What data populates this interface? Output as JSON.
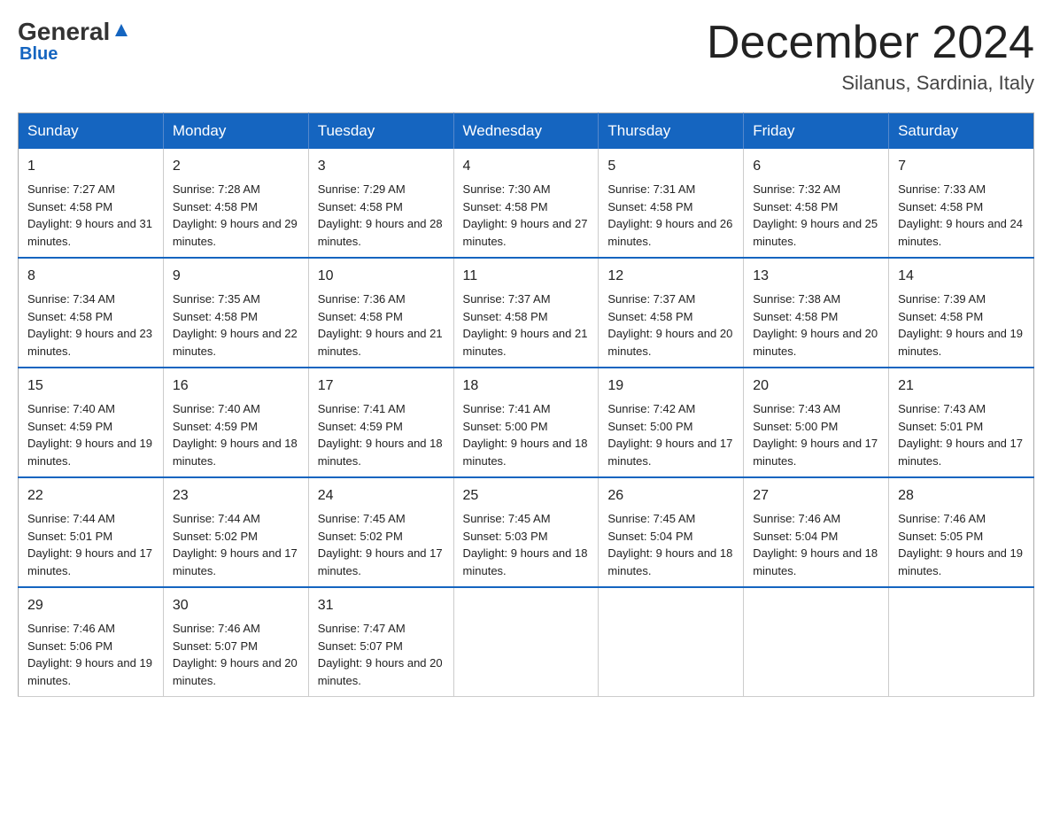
{
  "header": {
    "logo_general": "General",
    "logo_blue": "Blue",
    "month": "December 2024",
    "location": "Silanus, Sardinia, Italy"
  },
  "days_of_week": [
    "Sunday",
    "Monday",
    "Tuesday",
    "Wednesday",
    "Thursday",
    "Friday",
    "Saturday"
  ],
  "weeks": [
    [
      {
        "day": "1",
        "sunrise": "7:27 AM",
        "sunset": "4:58 PM",
        "daylight": "9 hours and 31 minutes."
      },
      {
        "day": "2",
        "sunrise": "7:28 AM",
        "sunset": "4:58 PM",
        "daylight": "9 hours and 29 minutes."
      },
      {
        "day": "3",
        "sunrise": "7:29 AM",
        "sunset": "4:58 PM",
        "daylight": "9 hours and 28 minutes."
      },
      {
        "day": "4",
        "sunrise": "7:30 AM",
        "sunset": "4:58 PM",
        "daylight": "9 hours and 27 minutes."
      },
      {
        "day": "5",
        "sunrise": "7:31 AM",
        "sunset": "4:58 PM",
        "daylight": "9 hours and 26 minutes."
      },
      {
        "day": "6",
        "sunrise": "7:32 AM",
        "sunset": "4:58 PM",
        "daylight": "9 hours and 25 minutes."
      },
      {
        "day": "7",
        "sunrise": "7:33 AM",
        "sunset": "4:58 PM",
        "daylight": "9 hours and 24 minutes."
      }
    ],
    [
      {
        "day": "8",
        "sunrise": "7:34 AM",
        "sunset": "4:58 PM",
        "daylight": "9 hours and 23 minutes."
      },
      {
        "day": "9",
        "sunrise": "7:35 AM",
        "sunset": "4:58 PM",
        "daylight": "9 hours and 22 minutes."
      },
      {
        "day": "10",
        "sunrise": "7:36 AM",
        "sunset": "4:58 PM",
        "daylight": "9 hours and 21 minutes."
      },
      {
        "day": "11",
        "sunrise": "7:37 AM",
        "sunset": "4:58 PM",
        "daylight": "9 hours and 21 minutes."
      },
      {
        "day": "12",
        "sunrise": "7:37 AM",
        "sunset": "4:58 PM",
        "daylight": "9 hours and 20 minutes."
      },
      {
        "day": "13",
        "sunrise": "7:38 AM",
        "sunset": "4:58 PM",
        "daylight": "9 hours and 20 minutes."
      },
      {
        "day": "14",
        "sunrise": "7:39 AM",
        "sunset": "4:58 PM",
        "daylight": "9 hours and 19 minutes."
      }
    ],
    [
      {
        "day": "15",
        "sunrise": "7:40 AM",
        "sunset": "4:59 PM",
        "daylight": "9 hours and 19 minutes."
      },
      {
        "day": "16",
        "sunrise": "7:40 AM",
        "sunset": "4:59 PM",
        "daylight": "9 hours and 18 minutes."
      },
      {
        "day": "17",
        "sunrise": "7:41 AM",
        "sunset": "4:59 PM",
        "daylight": "9 hours and 18 minutes."
      },
      {
        "day": "18",
        "sunrise": "7:41 AM",
        "sunset": "5:00 PM",
        "daylight": "9 hours and 18 minutes."
      },
      {
        "day": "19",
        "sunrise": "7:42 AM",
        "sunset": "5:00 PM",
        "daylight": "9 hours and 17 minutes."
      },
      {
        "day": "20",
        "sunrise": "7:43 AM",
        "sunset": "5:00 PM",
        "daylight": "9 hours and 17 minutes."
      },
      {
        "day": "21",
        "sunrise": "7:43 AM",
        "sunset": "5:01 PM",
        "daylight": "9 hours and 17 minutes."
      }
    ],
    [
      {
        "day": "22",
        "sunrise": "7:44 AM",
        "sunset": "5:01 PM",
        "daylight": "9 hours and 17 minutes."
      },
      {
        "day": "23",
        "sunrise": "7:44 AM",
        "sunset": "5:02 PM",
        "daylight": "9 hours and 17 minutes."
      },
      {
        "day": "24",
        "sunrise": "7:45 AM",
        "sunset": "5:02 PM",
        "daylight": "9 hours and 17 minutes."
      },
      {
        "day": "25",
        "sunrise": "7:45 AM",
        "sunset": "5:03 PM",
        "daylight": "9 hours and 18 minutes."
      },
      {
        "day": "26",
        "sunrise": "7:45 AM",
        "sunset": "5:04 PM",
        "daylight": "9 hours and 18 minutes."
      },
      {
        "day": "27",
        "sunrise": "7:46 AM",
        "sunset": "5:04 PM",
        "daylight": "9 hours and 18 minutes."
      },
      {
        "day": "28",
        "sunrise": "7:46 AM",
        "sunset": "5:05 PM",
        "daylight": "9 hours and 19 minutes."
      }
    ],
    [
      {
        "day": "29",
        "sunrise": "7:46 AM",
        "sunset": "5:06 PM",
        "daylight": "9 hours and 19 minutes."
      },
      {
        "day": "30",
        "sunrise": "7:46 AM",
        "sunset": "5:07 PM",
        "daylight": "9 hours and 20 minutes."
      },
      {
        "day": "31",
        "sunrise": "7:47 AM",
        "sunset": "5:07 PM",
        "daylight": "9 hours and 20 minutes."
      },
      null,
      null,
      null,
      null
    ]
  ],
  "labels": {
    "sunrise": "Sunrise: ",
    "sunset": "Sunset: ",
    "daylight": "Daylight: "
  }
}
